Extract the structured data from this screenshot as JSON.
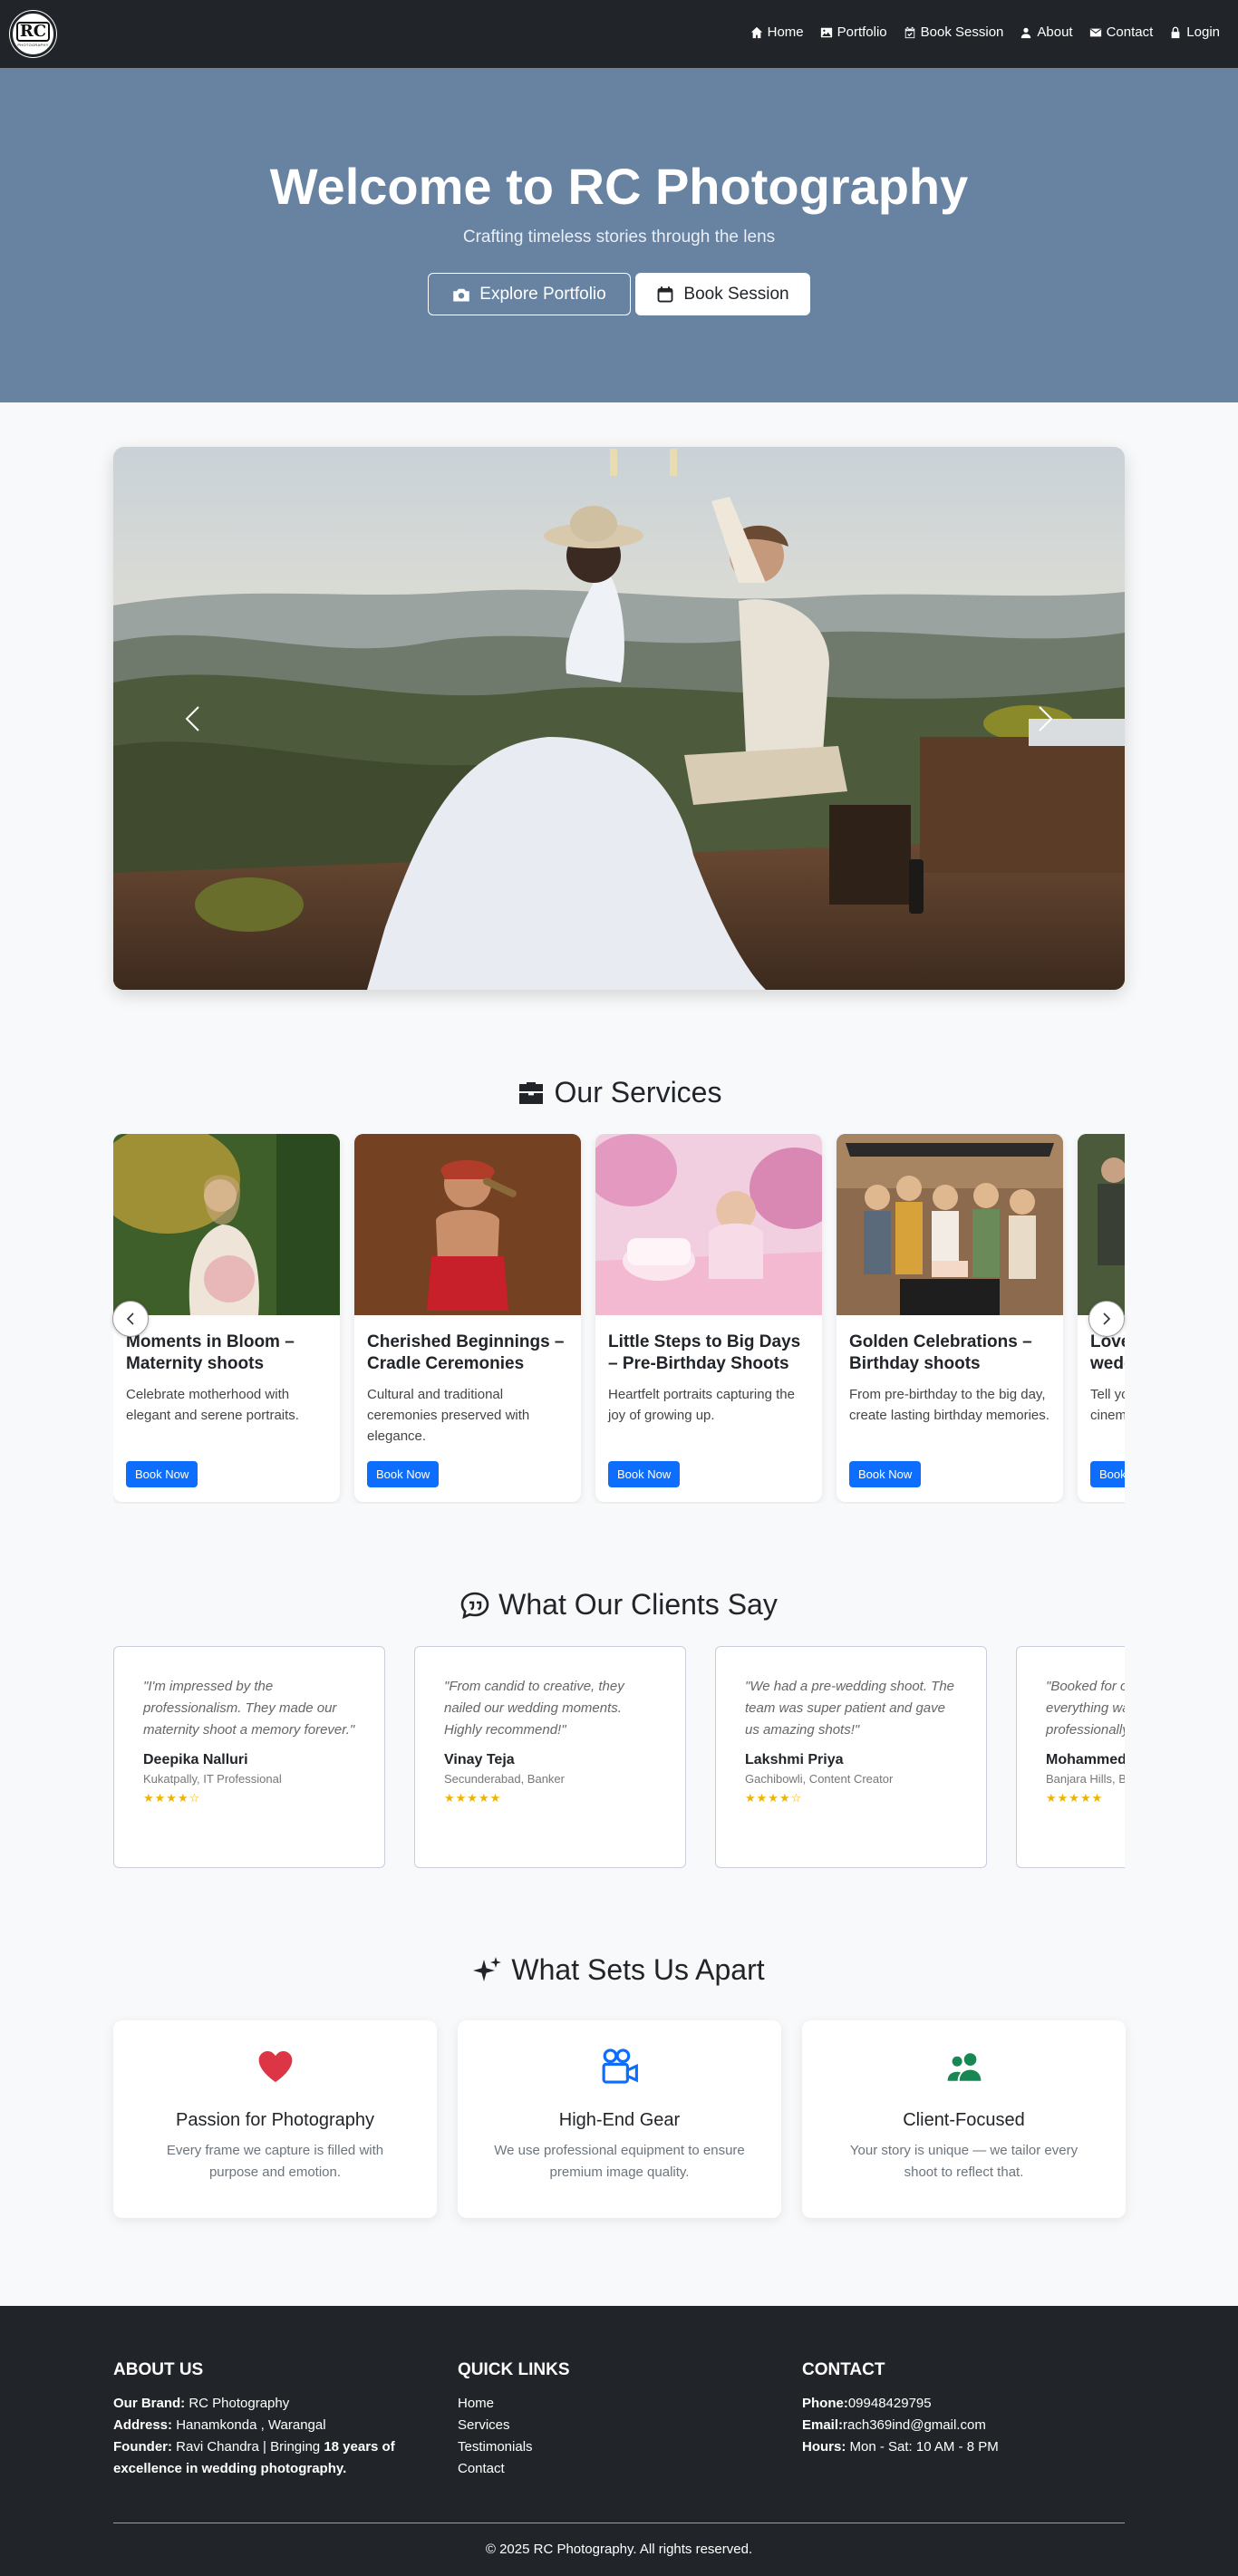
{
  "brand": {
    "logo_text": "RC",
    "logo_sub": "PHOTOGRAPHY"
  },
  "nav": {
    "items": [
      {
        "label": "Home",
        "icon": "house-icon"
      },
      {
        "label": "Portfolio",
        "icon": "image-icon"
      },
      {
        "label": "Book Session",
        "icon": "calendar-check-icon"
      },
      {
        "label": "About",
        "icon": "person-icon"
      },
      {
        "label": "Contact",
        "icon": "envelope-icon"
      },
      {
        "label": "Login",
        "icon": "lock-icon"
      }
    ]
  },
  "hero": {
    "title": "Welcome to RC Photography",
    "subtitle": "Crafting timeless stories through the lens",
    "btn_portfolio": "Explore Portfolio",
    "btn_book": "Book Session",
    "bg_color": "#6783a1"
  },
  "services": {
    "title": "Our Services",
    "items": [
      {
        "title": "Moments in Bloom – Maternity shoots",
        "desc": "Celebrate motherhood with elegant and serene portraits.",
        "button": "Book Now"
      },
      {
        "title": "Cherished Beginnings – Cradle Ceremonies",
        "desc": "Cultural and traditional ceremonies preserved with elegance.",
        "button": "Book Now"
      },
      {
        "title": "Little Steps to Big Days – Pre-Birthday Shoots",
        "desc": "Heartfelt portraits capturing the joy of growing up.",
        "button": "Book Now"
      },
      {
        "title": "Golden Celebrations – Birthday shoots",
        "desc": "From pre-birthday to the big day, create lasting birthday memories.",
        "button": "Book Now"
      },
      {
        "title": "Love Stories – Pre-wedding shoots",
        "desc": "Tell your love story with cinematic pre-wedding sessions.",
        "button": "Book Now"
      }
    ]
  },
  "testimonials": {
    "title": "What Our Clients Say",
    "items": [
      {
        "quote": "\"I'm impressed by the professionalism. They made our maternity shoot a memory forever.\"",
        "name": "Deepika Nalluri",
        "meta": "Kukatpally, IT Professional",
        "stars": "★★★★☆"
      },
      {
        "quote": "\"From candid to creative, they nailed our wedding moments. Highly recommend!\"",
        "name": "Vinay Teja",
        "meta": "Secunderabad, Banker",
        "stars": "★★★★★"
      },
      {
        "quote": "\"We had a pre-wedding shoot. The team was super patient and gave us amazing shots!\"",
        "name": "Lakshmi Priya",
        "meta": "Gachibowli, Content Creator",
        "stars": "★★★★☆"
      },
      {
        "quote": "\"Booked for our event and everything was handled professionally.\"",
        "name": "Mohammed",
        "meta": "Banjara Hills, B",
        "stars": "★★★★★"
      }
    ]
  },
  "features": {
    "title": "What Sets Us Apart",
    "items": [
      {
        "title": "Passion for Photography",
        "desc": "Every frame we capture is filled with purpose and emotion.",
        "icon": "heart-icon",
        "color": "#dc3545"
      },
      {
        "title": "High-End Gear",
        "desc": "We use professional equipment to ensure premium image quality.",
        "icon": "camera-reels-icon",
        "color": "#0d6efd"
      },
      {
        "title": "Client-Focused",
        "desc": "Your story is unique — we tailor every shoot to reflect that.",
        "icon": "people-icon",
        "color": "#198754"
      }
    ]
  },
  "footer": {
    "about": {
      "heading": "ABOUT US",
      "brand_label": "Our Brand:",
      "brand_value": " RC Photography",
      "address_label": "Address:",
      "address_value": " Hanamkonda , Warangal",
      "founder_label": "Founder:",
      "founder_value": " Ravi Chandra | Bringing ",
      "founder_highlight": "18 years of excellence in wedding photography."
    },
    "links": {
      "heading": "QUICK LINKS",
      "items": [
        "Home",
        "Services",
        "Testimonials",
        "Contact"
      ]
    },
    "contact": {
      "heading": "CONTACT",
      "phone_label": "Phone:",
      "phone_value": "09948429795",
      "email_label": "Email:",
      "email_value": "rach369ind@gmail.com",
      "hours_label": "Hours:",
      "hours_value": " Mon - Sat: 10 AM - 8 PM"
    },
    "copyright": "© 2025 RC Photography. All rights reserved."
  }
}
